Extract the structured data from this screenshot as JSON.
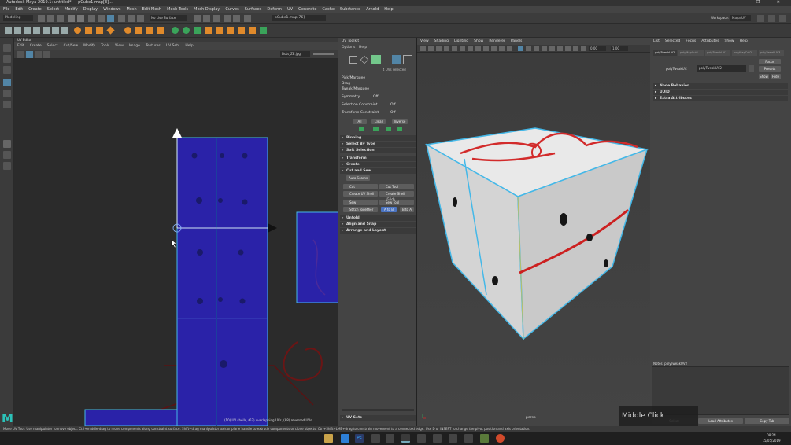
{
  "window": {
    "title": "Autodesk Maya 2019.1: untitled* --- pCube1.map[3]...",
    "controls": "— ❐ ✕"
  },
  "menubar": [
    "File",
    "Edit",
    "Create",
    "Select",
    "Modify",
    "Display",
    "Windows",
    "Mesh",
    "Edit Mesh",
    "Mesh Tools",
    "Mesh Display",
    "Curves",
    "Surfaces",
    "Deform",
    "UV",
    "Generate",
    "Cache",
    "Substance",
    "Arnold",
    "Help"
  ],
  "shelf": {
    "mode": "Modeling",
    "live_surface": "No Live Surface",
    "selection_field": "pCube1.map[76]",
    "workspace_label": "Workspace:",
    "workspace_value": "Maya UV"
  },
  "uv_editor": {
    "title": "UV Editor",
    "menu": [
      "Edit",
      "Create",
      "Select",
      "Cut/Sew",
      "Modify",
      "Tools",
      "View",
      "Image",
      "Textures",
      "UV Sets",
      "Help"
    ],
    "texture": "Dots_ZE.jpg",
    "status": "(10) UV shells, (62) overlapping UVs, (88) reversed UVs"
  },
  "uv_toolkit": {
    "title": "UV Toolkit",
    "menu": [
      "Options",
      "Help"
    ],
    "selected_count": "4 UVs selected",
    "modes": [
      "Pick/Marquee",
      "Drag",
      "Tweak/Marquee"
    ],
    "symmetry": {
      "label": "Symmetry",
      "value": "Off"
    },
    "selection_constraint": {
      "label": "Selection Constraint",
      "value": "Off"
    },
    "transform_constraint": {
      "label": "Transform Constraint",
      "value": "Off"
    },
    "select_buttons": [
      "All",
      "Clear",
      "Inverse"
    ],
    "sections": [
      "Pinning",
      "Select By Type",
      "Soft Selection",
      "Transform",
      "Create",
      "Cut and Sew",
      "Unfold",
      "Align and Snap",
      "Arrange and Layout"
    ],
    "cut_sew": {
      "auto_seams": "Auto Seams",
      "cut": "Cut",
      "cut_tool": "Cut Tool",
      "create_uv_shell": "Create UV Shell",
      "create_shell_grid": "Create Shell (Grid)",
      "sew": "Sew",
      "sew_tool": "Sew Tool",
      "stitch_together": "Stitch Together",
      "a_to_b": "A to B",
      "b_to_a": "B to A"
    },
    "uv_sets": "UV Sets"
  },
  "viewport": {
    "menu": [
      "View",
      "Shading",
      "Lighting",
      "Show",
      "Renderer",
      "Panels"
    ],
    "value1": "0.00",
    "value2": "1.00",
    "camera": "persp"
  },
  "attribute_editor": {
    "menu": [
      "List",
      "Selected",
      "Focus",
      "Attributes",
      "Show",
      "Help"
    ],
    "node": "polyTweakUV2",
    "tabs": [
      "polyTweakUV2",
      "polyMapCut1",
      "polyTweakUV1",
      "polyMapCut2",
      "polyTweakUV3"
    ],
    "label": "polyTweakUV:",
    "value": "polyTweakUV2",
    "focus": "Focus",
    "presets": "Presets",
    "show": "Show",
    "hide": "Hide",
    "sections": [
      "Node Behavior",
      "UUID",
      "Extra Attributes"
    ],
    "notes": "Notes: polyTweakUV2",
    "buttons": [
      "Select",
      "Load Attributes",
      "Copy Tab"
    ]
  },
  "statusbar": "Move UV Tool: Use manipulator to move object. Ctrl+middle-drag to move components along constraint surface. Shift+drag manipulator axis or plane handle to extrude components or clone objects. Ctrl+Shift+LMB+drag to constrain movement to a connected edge. Use D or INSERT to change the pivot position and axis orientation.",
  "middle_click": "Middle Click",
  "taskbar": {
    "time": "08:24",
    "date": "15/05/2019"
  },
  "colors": {
    "uv_shell": "#2a22a8",
    "selection": "#44b8e8",
    "accent": "#5285a6",
    "stitch": "#4b74c2"
  }
}
